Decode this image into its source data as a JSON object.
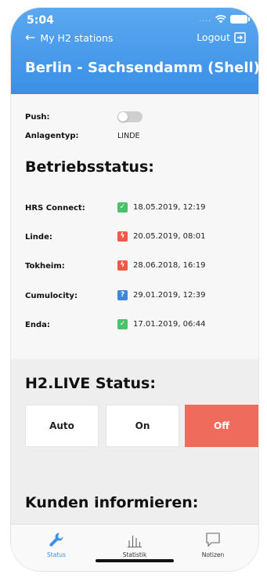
{
  "status_bar": {
    "time": "5:04",
    "dots": "...."
  },
  "nav": {
    "back_label": "My H2 stations",
    "logout_label": "Logout"
  },
  "station": {
    "title": "Berlin - Sachsendamm (Shell)"
  },
  "details": {
    "push_label": "Push:",
    "push_enabled": false,
    "anlagentyp_label": "Anlagentyp:",
    "anlagentyp_value": "LINDE"
  },
  "betriebsstatus": {
    "heading": "Betriebsstatus:",
    "rows": [
      {
        "name": "HRS Connect:",
        "status": "ok",
        "icon": "check-icon",
        "color": "#4cc16b",
        "glyph": "✓",
        "date": "18.05.2019, 12:19"
      },
      {
        "name": "Linde:",
        "status": "error",
        "icon": "bolt-icon",
        "color": "#ee5a45",
        "glyph": "ϟ",
        "date": "20.05.2019, 08:01"
      },
      {
        "name": "Tokheim:",
        "status": "error",
        "icon": "bolt-icon",
        "color": "#ee5a45",
        "glyph": "ϟ",
        "date": "28.06.2018, 16:19"
      },
      {
        "name": "Cumulocity:",
        "status": "unknown",
        "icon": "question-icon",
        "color": "#3f86e0",
        "glyph": "?",
        "date": "29.01.2019, 12:39"
      },
      {
        "name": "Enda:",
        "status": "ok",
        "icon": "check-icon",
        "color": "#4cc16b",
        "glyph": "✓",
        "date": "17.01.2019, 06:44"
      }
    ]
  },
  "h2live": {
    "heading": "H2.LIVE Status:",
    "buttons": [
      {
        "label": "Auto",
        "selected": false
      },
      {
        "label": "On",
        "selected": false
      },
      {
        "label": "Off",
        "selected": true
      }
    ],
    "selected_color": "#ef6b5b"
  },
  "kunden": {
    "heading": "Kunden informieren:"
  },
  "tabs": [
    {
      "label": "Status",
      "icon": "wrench-icon",
      "active": true
    },
    {
      "label": "Statistik",
      "icon": "bar-chart-icon",
      "active": false
    },
    {
      "label": "Notizen",
      "icon": "note-icon",
      "active": false
    }
  ],
  "colors": {
    "accent": "#3a8fe6",
    "ok": "#4cc16b",
    "error": "#ee5a45",
    "info": "#3f86e0"
  }
}
